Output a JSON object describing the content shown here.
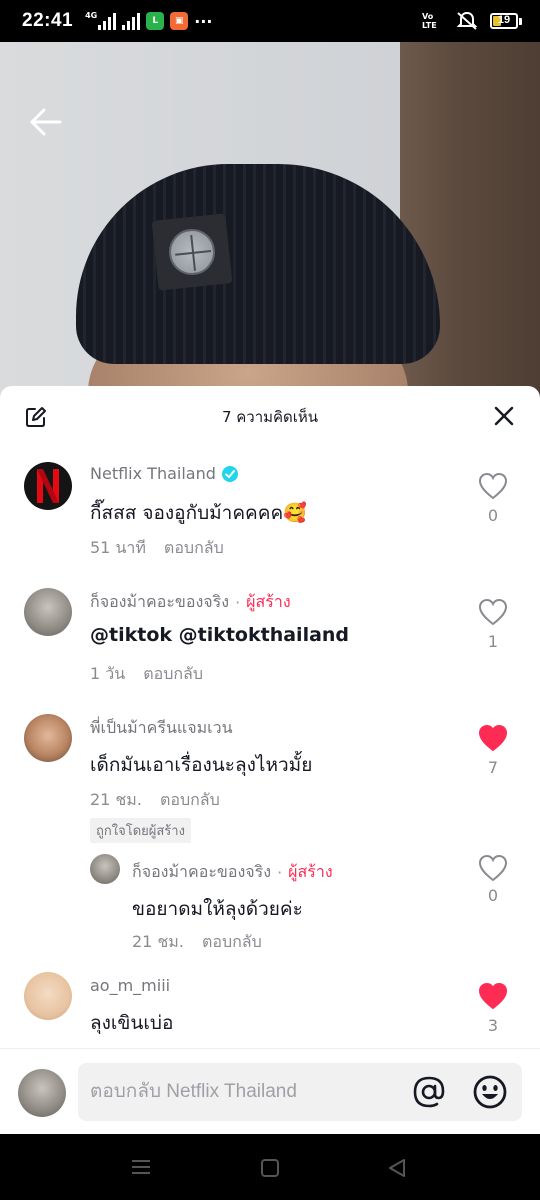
{
  "status_bar": {
    "time": "22:41",
    "network": "4G",
    "volte": "Vo LTE",
    "battery": "19",
    "more": "···"
  },
  "sheet": {
    "title": "7 ความคิดเห็น"
  },
  "comments": [
    {
      "username": "Netflix Thailand",
      "verified": true,
      "text": "กี๊สสส จองอูกับม้าคคคค🥰",
      "time": "51 นาที",
      "reply": "ตอบกลับ",
      "likes": "0",
      "liked": false
    },
    {
      "username": "ก็จองม้าคอะของจริง",
      "creator_tag": "ผู้สร้าง",
      "text": "@tiktok @tiktokthailand",
      "time": "1 วัน",
      "reply": "ตอบกลับ",
      "likes": "1",
      "liked": false
    },
    {
      "username": "พี่เป็นม้าครีนแจมเวน",
      "text": "เด็กมันเอาเรื่องนะลุงไหวมั้ย",
      "time": "21 ชม.",
      "reply": "ตอบกลับ",
      "likes": "7",
      "liked": true,
      "liked_by_creator": "ถูกใจโดยผู้สร้าง"
    },
    {
      "username": "ก็จองม้าคอะของจริง",
      "creator_tag": "ผู้สร้าง",
      "text": "ขอยาดมให้ลุงด้วยค่ะ",
      "time": "21 ชม.",
      "reply": "ตอบกลับ",
      "likes": "0",
      "liked": false
    },
    {
      "username": "ao_m_miii",
      "text": "ลุงเขินเบ่อ",
      "likes": "3",
      "liked": true
    }
  ],
  "input": {
    "placeholder": "ตอบกลับ Netflix Thailand"
  },
  "colors": {
    "accent": "#fe2c55",
    "verified": "#20d5ec",
    "netflix_red": "#e50914"
  }
}
